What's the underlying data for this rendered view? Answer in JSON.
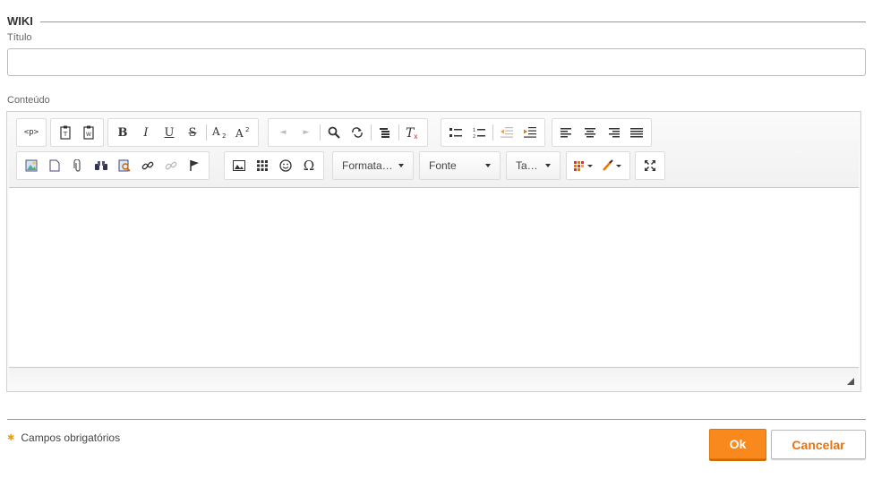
{
  "section": {
    "title": "WIKI"
  },
  "fields": {
    "title_label": "Título",
    "title_value": "",
    "content_label": "Conteúdo"
  },
  "toolbar": {
    "format_combo": "Formata…",
    "font_combo": "Fonte",
    "size_combo": "Ta…",
    "bold": "B",
    "italic": "I",
    "underline": "U",
    "strike": "S",
    "omega": "Ω",
    "source": "<p>"
  },
  "footer": {
    "required_text": "Campos obrigatórios",
    "ok_label": "Ok",
    "cancel_label": "Cancelar"
  },
  "colors": {
    "accent": "#f9891c",
    "cancel_text": "#e8730f"
  }
}
